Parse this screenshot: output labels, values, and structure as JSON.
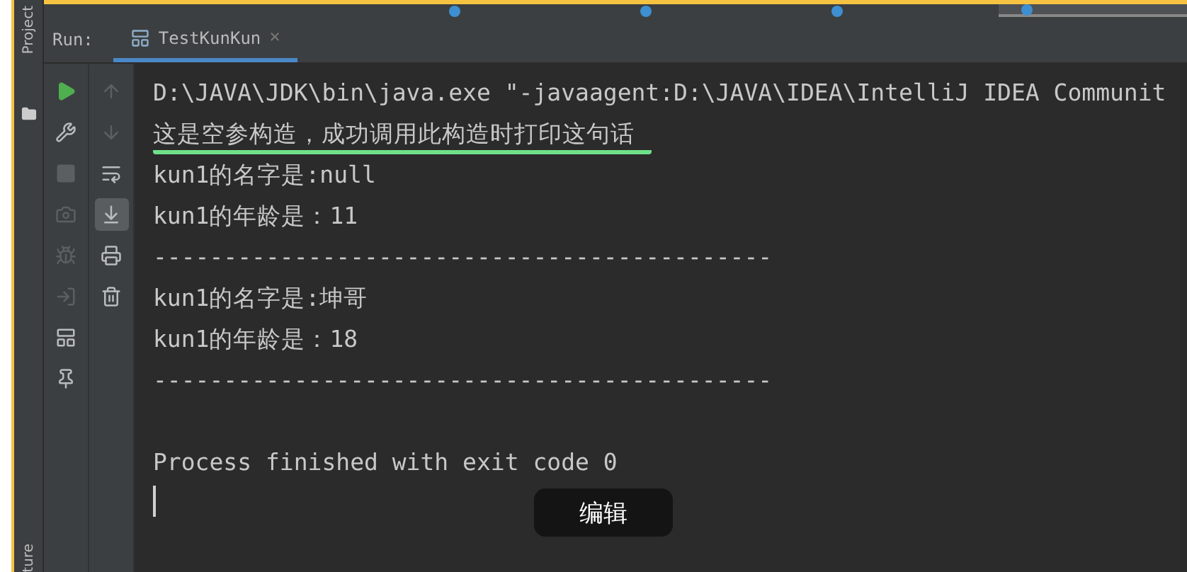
{
  "editor_tabs": [
    {
      "selected": false
    },
    {
      "selected": false
    },
    {
      "selected": false
    },
    {
      "selected": true
    }
  ],
  "side_strip": {
    "top_label": "Project",
    "bottom_label": "ture"
  },
  "run_panel": {
    "label": "Run:",
    "tab": {
      "title": "TestKunKun",
      "close": "×",
      "selected": true
    }
  },
  "run_toolbar": [
    {
      "disabled": false
    },
    {
      "disabled": false
    },
    {
      "disabled": true
    },
    {
      "disabled": true
    },
    {
      "disabled": true
    },
    {
      "disabled": true
    },
    {
      "disabled": false
    },
    {
      "disabled": false
    }
  ],
  "console_toolbar": [
    {
      "disabled": true,
      "selected": false
    },
    {
      "disabled": true,
      "selected": false
    },
    {
      "disabled": false,
      "selected": false
    },
    {
      "disabled": false,
      "selected": true
    },
    {
      "disabled": false,
      "selected": false
    },
    {
      "disabled": false,
      "selected": false
    }
  ],
  "console": {
    "lines": [
      {
        "kind": "text",
        "text": "D:\\JAVA\\JDK\\bin\\java.exe \"-javaagent:D:\\JAVA\\IDEA\\IntelliJ IDEA Communit"
      },
      {
        "kind": "text",
        "text": "这是空参构造，成功调用此构造时打印这句话",
        "underlined": true
      },
      {
        "kind": "text",
        "text": "kun1的名字是:null"
      },
      {
        "kind": "text",
        "text": "kun1的年龄是：11"
      },
      {
        "kind": "text",
        "text": "--------------------------------------------"
      },
      {
        "kind": "text",
        "text": "kun1的名字是:坤哥"
      },
      {
        "kind": "text",
        "text": "kun1的年龄是：18"
      },
      {
        "kind": "text",
        "text": "--------------------------------------------"
      },
      {
        "kind": "blank"
      },
      {
        "kind": "text",
        "text": "Process finished with exit code 0"
      }
    ],
    "cursor": true
  },
  "toast": "编辑"
}
